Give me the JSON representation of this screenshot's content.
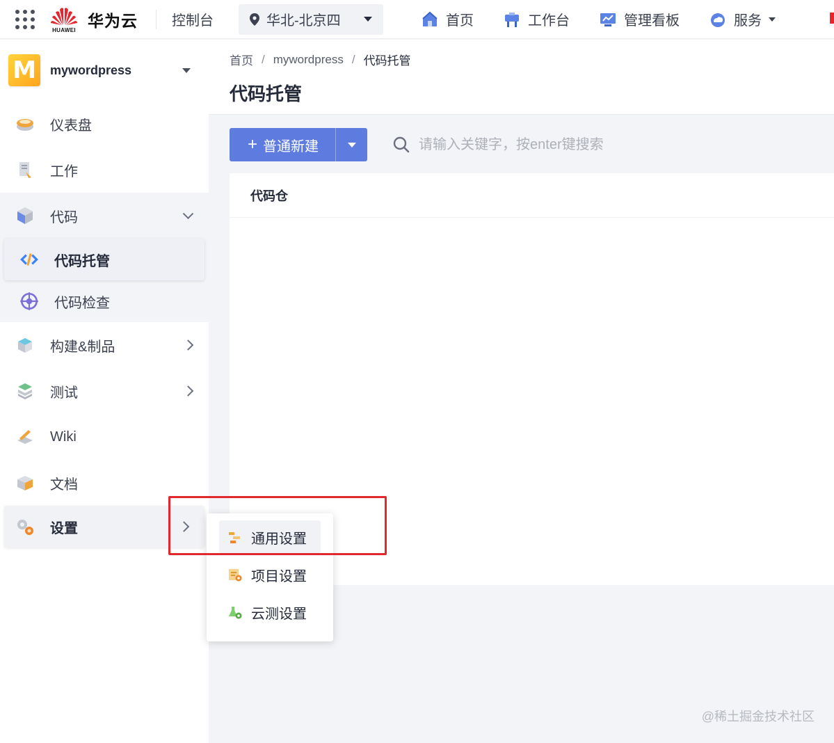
{
  "topbar": {
    "brand_small": "HUAWEI",
    "brand_name": "华为云",
    "console": "控制台",
    "region": "华北-北京四",
    "nav": [
      {
        "label": "首页",
        "icon": "home-icon"
      },
      {
        "label": "工作台",
        "icon": "workbench-icon"
      },
      {
        "label": "管理看板",
        "icon": "dashboard-board-icon"
      },
      {
        "label": "服务",
        "icon": "service-cloud-icon"
      }
    ]
  },
  "sidebar": {
    "project_avatar_letter": "M",
    "project_name": "mywordpress",
    "items": {
      "dashboard": "仪表盘",
      "work": "工作",
      "code": "代码",
      "code_hosting": "代码托管",
      "code_check": "代码检查",
      "build": "构建&制品",
      "test": "测试",
      "wiki": "Wiki",
      "docs": "文档",
      "settings": "设置"
    }
  },
  "main": {
    "breadcrumb": [
      "首页",
      "mywordpress",
      "代码托管"
    ],
    "breadcrumb_sep": "/",
    "title": "代码托管",
    "new_button": "普通新建",
    "new_button_plus": "+",
    "search_placeholder": "请输入关键字，按enter键搜索",
    "panel_header": "代码仓"
  },
  "flyout": {
    "items": [
      "通用设置",
      "项目设置",
      "云测设置"
    ]
  },
  "watermark": "@稀土掘金技术社区",
  "colors": {
    "primary": "#5e7ce0",
    "highlight": "#e0282e",
    "brand_red": "#e4262e"
  }
}
